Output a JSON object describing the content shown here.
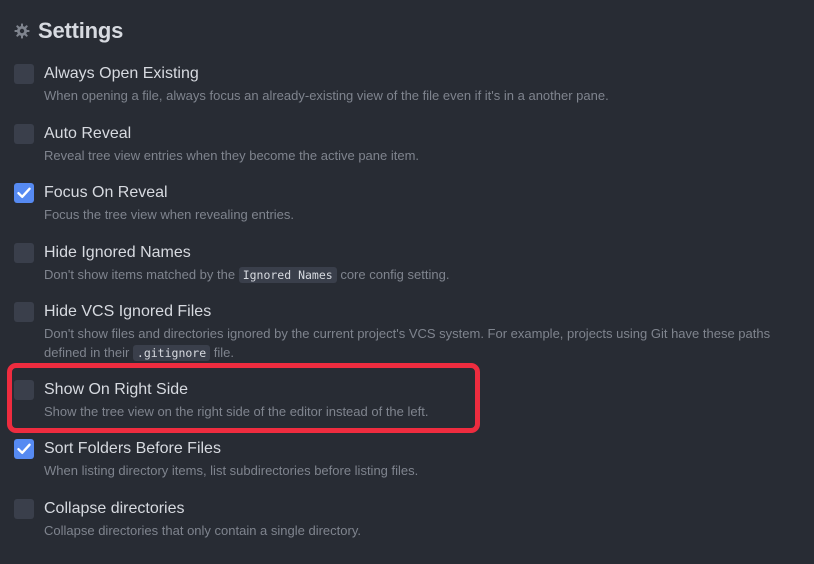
{
  "header": {
    "title": "Settings",
    "icon": "gear-icon"
  },
  "settings": [
    {
      "label": "Always Open Existing",
      "description": "When opening a file, always focus an already-existing view of the file even if it's in a another pane.",
      "checked": false
    },
    {
      "label": "Auto Reveal",
      "description": "Reveal tree view entries when they become the active pane item.",
      "checked": false
    },
    {
      "label": "Focus On Reveal",
      "description": "Focus the tree view when revealing entries.",
      "checked": true
    },
    {
      "label": "Hide Ignored Names",
      "description_before": "Don't show items matched by the ",
      "description_code": "Ignored Names",
      "description_after": " core config setting.",
      "checked": false
    },
    {
      "label": "Hide VCS Ignored Files",
      "description_before": "Don't show files and directories ignored by the current project's VCS system. For example, projects using Git have these paths defined in their ",
      "description_code": ".gitignore",
      "description_after": " file.",
      "checked": false
    },
    {
      "label": "Show On Right Side",
      "description": "Show the tree view on the right side of the editor instead of the left.",
      "checked": false
    },
    {
      "label": "Sort Folders Before Files",
      "description": "When listing directory items, list subdirectories before listing files.",
      "checked": true
    },
    {
      "label": "Collapse directories",
      "description": "Collapse directories that only contain a single directory.",
      "checked": false
    }
  ],
  "colors": {
    "background": "#282c34",
    "checkbox_checked": "#568af2",
    "highlight": "#ee2c3f"
  }
}
